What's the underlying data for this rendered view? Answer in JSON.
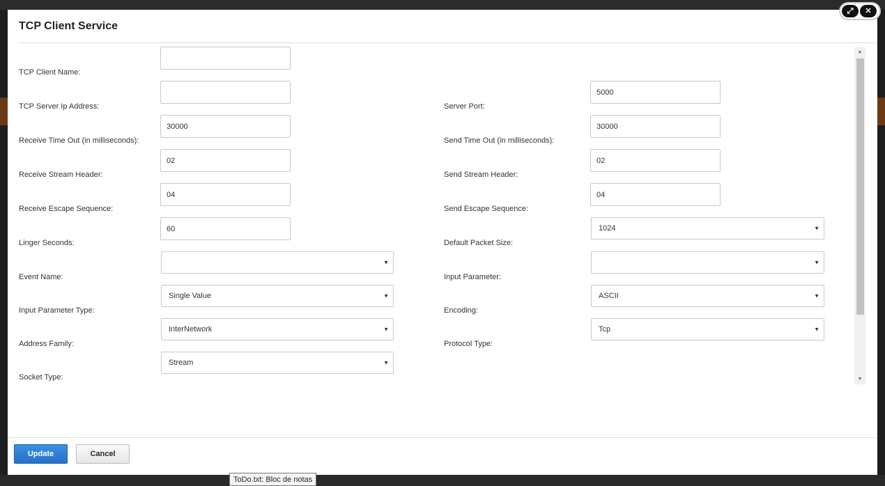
{
  "dialog": {
    "title": "TCP Client Service",
    "update_label": "Update",
    "cancel_label": "Cancel"
  },
  "fields": {
    "tcp_client_name": {
      "label": "TCP Client Name:",
      "value": ""
    },
    "tcp_server_ip": {
      "label": "TCP Server Ip Address:",
      "value": ""
    },
    "server_port": {
      "label": "Server Port:",
      "value": "5000"
    },
    "receive_timeout": {
      "label": "Receive Time Out (in milliseconds):",
      "value": "30000"
    },
    "send_timeout": {
      "label": "Send Time Out (in milliseconds):",
      "value": "30000"
    },
    "receive_stream_header": {
      "label": "Receive Stream Header:",
      "value": "02"
    },
    "send_stream_header": {
      "label": "Send Stream Header:",
      "value": "02"
    },
    "receive_escape_sequence": {
      "label": "Receive Escape Sequence:",
      "value": "04"
    },
    "send_escape_sequence": {
      "label": "Send Escape Sequence:",
      "value": "04"
    },
    "linger_seconds": {
      "label": "Linger Seconds:",
      "value": "60"
    },
    "default_packet_size": {
      "label": "Default Packet Size:",
      "value": "1024"
    },
    "event_name": {
      "label": "Event Name:",
      "value": ""
    },
    "input_parameter": {
      "label": "Input Parameter:",
      "value": ""
    },
    "input_parameter_type": {
      "label": "Input Parameter Type:",
      "value": "Single Value"
    },
    "encoding": {
      "label": "Encoding:",
      "value": "ASCII"
    },
    "address_family": {
      "label": "Address Family:",
      "value": "InterNetwork"
    },
    "protocol_type": {
      "label": "Protocol Type:",
      "value": "Tcp"
    },
    "socket_type": {
      "label": "Socket Type:",
      "value": "Stream"
    }
  },
  "taskbar": {
    "tooltip": "ToDo.txt: Bloc de notas"
  },
  "icons": {
    "maximize": "expand-arrows-icon",
    "close": "x-icon",
    "dropdown": "triangle-down-icon"
  }
}
